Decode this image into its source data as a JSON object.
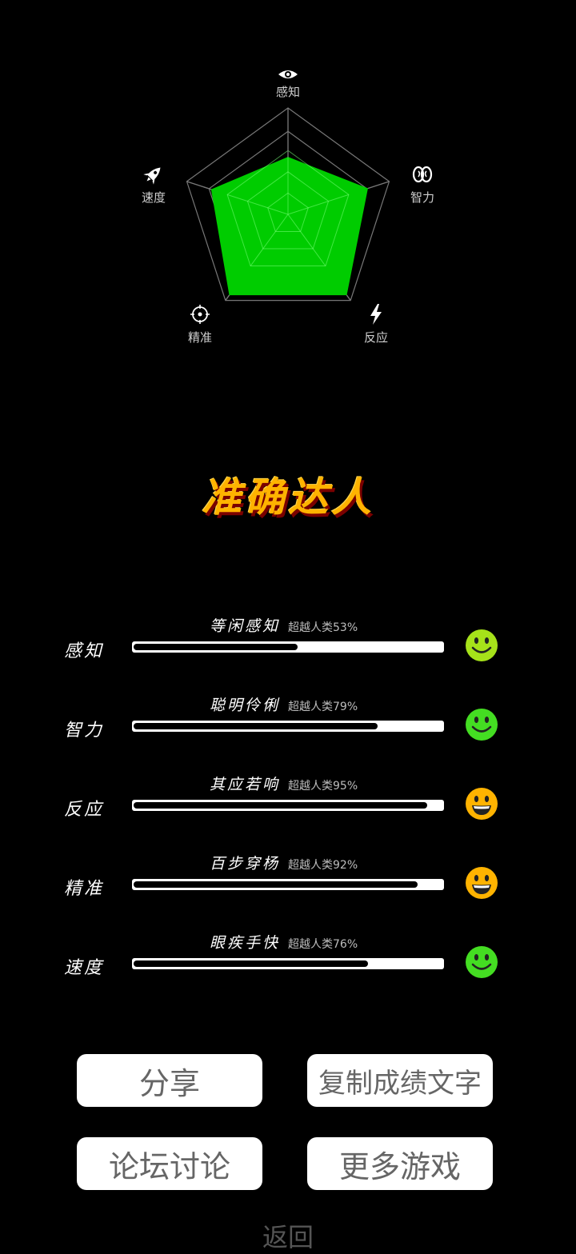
{
  "radar": {
    "axes": [
      {
        "label": "感知",
        "icon": "eye-icon",
        "value": 0.54
      },
      {
        "label": "智力",
        "icon": "brain-icon",
        "value": 0.79
      },
      {
        "label": "反应",
        "icon": "lightning-icon",
        "value": 0.94
      },
      {
        "label": "精准",
        "icon": "target-icon",
        "value": 0.94
      },
      {
        "label": "速度",
        "icon": "rocket-icon",
        "value": 0.76
      }
    ],
    "fill_color": "#00cc00",
    "grid_color": "#777777"
  },
  "title": "准确达人",
  "stats": [
    {
      "name": "感知",
      "phrase": "等闲感知",
      "percent_text": "超越人类53%",
      "value": 0.53,
      "smiley": "smile",
      "color": "#a6e21a"
    },
    {
      "name": "智力",
      "phrase": "聪明伶俐",
      "percent_text": "超越人类79%",
      "value": 0.79,
      "smiley": "smile",
      "color": "#44dd22"
    },
    {
      "name": "反应",
      "phrase": "其应若响",
      "percent_text": "超越人类95%",
      "value": 0.95,
      "smiley": "grin",
      "color": "#ffb300"
    },
    {
      "name": "精准",
      "phrase": "百步穿杨",
      "percent_text": "超越人类92%",
      "value": 0.92,
      "smiley": "grin",
      "color": "#ffb300"
    },
    {
      "name": "速度",
      "phrase": "眼疾手快",
      "percent_text": "超越人类76%",
      "value": 0.76,
      "smiley": "smile",
      "color": "#44dd22"
    }
  ],
  "buttons": {
    "share": "分享",
    "copy": "复制成绩文字",
    "forum": "论坛讨论",
    "more": "更多游戏"
  },
  "back": "返回"
}
